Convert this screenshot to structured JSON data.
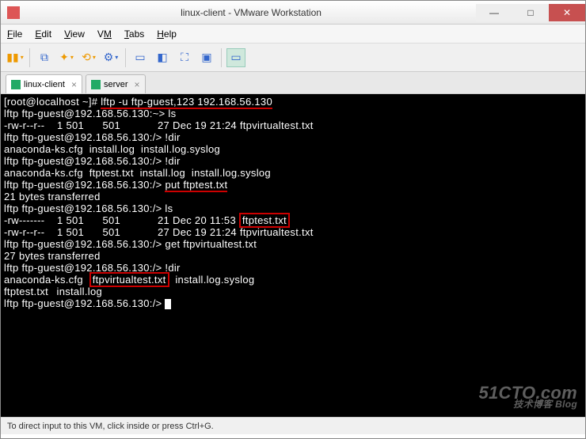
{
  "window": {
    "title": "linux-client - VMware Workstation"
  },
  "menu": {
    "file": "File",
    "edit": "Edit",
    "view": "View",
    "vm": "VM",
    "tabs": "Tabs",
    "help": "Help"
  },
  "tabs": {
    "t1": "linux-client",
    "t2": "server"
  },
  "term": {
    "l1a": "[root@localhost ~]# ",
    "l1b": "lftp -u ftp-guest,123 192.168.56.130",
    "l2": "lftp ftp-guest@192.168.56.130:~> ls",
    "l3": "-rw-r--r--    1 501      501            27 Dec 19 21:24 ftpvirtualtest.txt",
    "l4": "lftp ftp-guest@192.168.56.130:/> !dir",
    "l5": "anaconda-ks.cfg  install.log  install.log.syslog",
    "l6": "lftp ftp-guest@192.168.56.130:/> !dir",
    "l7": "anaconda-ks.cfg  ftptest.txt  install.log  install.log.syslog",
    "l8a": "lftp ftp-guest@192.168.56.130:/> ",
    "l8b": "put ftptest.txt",
    "l9": "21 bytes transferred",
    "l10": "lftp ftp-guest@192.168.56.130:/> ls",
    "l11a": "-rw-------    1 501      501            21 Dec 20 11:53 ",
    "l11b": "ftptest.txt",
    "l12": "-rw-r--r--    1 501      501            27 Dec 19 21:24 ftpvirtualtest.txt",
    "l13": "lftp ftp-guest@192.168.56.130:/> get ftpvirtualtest.txt",
    "l14": "27 bytes transferred",
    "l15": "lftp ftp-guest@192.168.56.130:/> !dir",
    "l16a": "anaconda-ks.cfg  ",
    "l16b": "ftpvirtualtest.txt",
    "l16c": "  install.log.syslog",
    "l17": "ftptest.txt\t install.log",
    "l18": "lftp ftp-guest@192.168.56.130:/> "
  },
  "watermark": {
    "main": "51CTO.com",
    "sub": "技术博客  Blog"
  },
  "status": {
    "text": "To direct input to this VM, click inside or press Ctrl+G."
  }
}
